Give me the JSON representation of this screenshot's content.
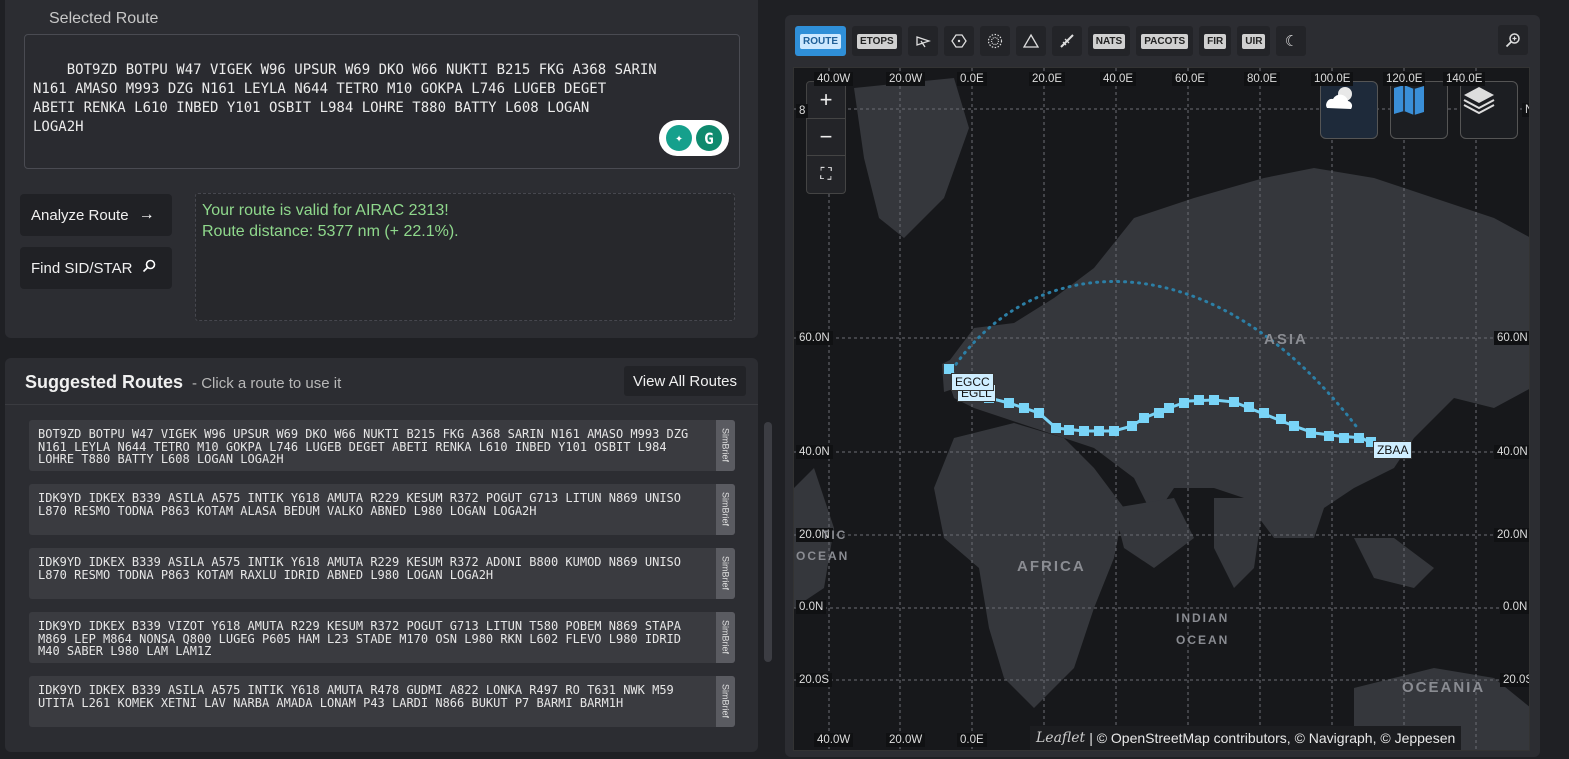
{
  "selected_route": {
    "title": "Selected Route",
    "text": "BOT9ZD BOTPU W47 VIGEK W96 UPSUR W69 DKO W66 NUKTI B215 FKG A368 SARIN\nN161 AMASO M993 DZG N161 LEYLA N644 TETRO M10 GOKPA L746 LUGEB DEGET\nABETI RENKA L610 INBED Y101 OSBIT L984 LOHRE T880 BATTY L608 LOGAN\nLOGA2H"
  },
  "buttons": {
    "analyze": "Analyze Route",
    "find_sid_star": "Find SID/STAR"
  },
  "validation": {
    "line1": "Your route is valid for AIRAC 2313!",
    "line2": "Route distance: 5377 nm (+ 22.1%)."
  },
  "suggested": {
    "title": "Suggested Routes",
    "subtitle": "- Click a route to use it",
    "view_all": "View All Routes",
    "simbrief_label": "SimBrief",
    "routes": [
      "BOT9ZD BOTPU W47 VIGEK W96 UPSUR W69 DKO W66 NUKTI B215 FKG A368 SARIN N161 AMASO M993 DZG N161 LEYLA N644 TETRO M10 GOKPA L746 LUGEB DEGET ABETI RENKA L610 INBED Y101 OSBIT L984 LOHRE T880 BATTY L608 LOGAN LOGA2H",
      "IDK9YD IDKEX B339 ASILA A575 INTIK Y618 AMUTA R229 KESUM R372 POGUT G713 LITUN N869 UNISO L870 RESMO TODNA P863 KOTAM ALASA BEDUM VALKO ABNED L980 LOGAN LOGA2H",
      "IDK9YD IDKEX B339 ASILA A575 INTIK Y618 AMUTA R229 KESUM R372 ADONI B800 KUMOD N869 UNISO L870 RESMO TODNA P863 KOTAM RAXLU IDRID ABNED L980 LOGAN LOGA2H",
      "IDK9YD IDKEX B339 VIZOT Y618 AMUTA R229 KESUM R372 POGUT G713 LITUN T580 POBEM N869 STAPA M869 LEP M864 NONSA Q800 LUGEG P605 HAM L23 STADE M170 OSN L980 RKN L602 FLEVO L980 IDRID M40 SABER L980 LAM LAM1Z",
      "IDK9YD IDKEX B339 ASILA A575 INTIK Y618 AMUTA R478 GUDMI A822 LONKA R497 RO T631 NWK M59 UTITA L261 KOMEK XETNI LAV NARBA AMADA LONAM P43 LARDI N866 BUKUT P7 BARMI BARM1H"
    ]
  },
  "map_toolbar": {
    "route": "ROUTE",
    "etops": "ETOPS",
    "nats": "NATS",
    "pacots": "PACOTS",
    "fir": "FIR",
    "uir": "UIR"
  },
  "map": {
    "lon_labels_top": [
      "40.0W",
      "20.0W",
      "0.0E",
      "20.0E",
      "40.0E",
      "60.0E",
      "80.0E",
      "100.0E",
      "120.0E",
      "140.0E"
    ],
    "lon_labels_bottom": [
      "40.0W",
      "20.0W",
      "0.0E"
    ],
    "lat_labels": [
      "60.0N",
      "40.0N",
      "20.0N",
      "0.0N",
      "20.0S"
    ],
    "lat_labels_left": [
      "60.0N",
      "40.0N",
      "20.0N",
      "0.0N",
      "20.0S"
    ],
    "left_partial_labels": [
      "8",
      "TIC",
      "OCEAN"
    ],
    "right_partial_label": "N",
    "continents": {
      "asia": "ASIA",
      "africa": "AFRICA",
      "indian_ocean_1": "INDIAN",
      "indian_ocean_2": "OCEAN",
      "oceania": "OCEANIA"
    },
    "airports": {
      "origin": "EGCC",
      "origin_under": "EGLL",
      "destination": "ZBAA"
    },
    "route_color": "#79d4f7",
    "attribution_logo": "Leaflet",
    "attribution": "| © OpenStreetMap contributors, © Navigraph, © Jeppesen",
    "zoom_in": "+",
    "zoom_out": "−"
  }
}
